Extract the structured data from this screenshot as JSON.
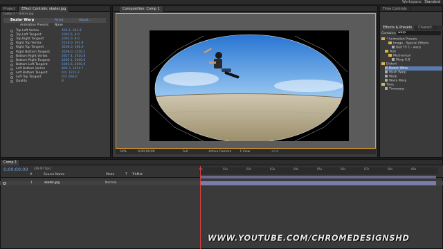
{
  "workspace": {
    "label": "Workspace:",
    "value": "Standard"
  },
  "left_panel": {
    "tabs": [
      "Project",
      "Effect Controls: skater.jpg"
    ],
    "breadcrumb": "Comp 1 * skater.jpg",
    "effect": {
      "name": "Bezier Warp",
      "reset": "Reset",
      "about": "About..."
    },
    "animation_presets": {
      "label": "Animation Presets:",
      "value": "None"
    },
    "properties": [
      {
        "label": "Top Left Vertex",
        "value": "426.1, 361.8"
      },
      {
        "label": "Top Left Tangent",
        "value": "1003.6, 8.0"
      },
      {
        "label": "Top Right Tangent",
        "value": "2003.0, 8.0"
      },
      {
        "label": "Right Top Vertex",
        "value": "2518.0, 361.8"
      },
      {
        "label": "Right Top Tangent",
        "value": "3508.0, 586.6"
      },
      {
        "label": "Right Bottom Tangent",
        "value": "3508.0, 1250.2"
      },
      {
        "label": "Bottom Right Vertex",
        "value": "2627.4, 1610.8"
      },
      {
        "label": "Bottom Right Tangent",
        "value": "2005.1, 2000.0"
      },
      {
        "label": "Bottom Left Tangent",
        "value": "1003.6, 2000.0"
      },
      {
        "label": "Left Bottom Vertex",
        "value": "404.3, 1654.7"
      },
      {
        "label": "Left Bottom Tangent",
        "value": "0.0, 1223.2"
      },
      {
        "label": "Left Top Tangent",
        "value": "0.0, 666.6"
      },
      {
        "label": "Quality",
        "value": "8"
      }
    ]
  },
  "viewer": {
    "tab": "Composition: Comp 1",
    "breadcrumb": "Comp 1",
    "zoom": "50%",
    "timecode": "0;00;00;00",
    "resolution": "Full",
    "camera": "Active Camera",
    "view": "1 View",
    "offset": "+0.0"
  },
  "right_panel": {
    "top_tab": "Time Controls",
    "tabs": [
      "Effects & Presets",
      "Charact"
    ],
    "search_label": "Contains:",
    "search_value": "warp",
    "tree": [
      {
        "text": "* Animation Presets",
        "level": 0,
        "kind": "folder"
      },
      {
        "text": "Image - Special Effects",
        "level": 2,
        "kind": "folder"
      },
      {
        "text": "Bad TV 1 - warp",
        "level": 3,
        "kind": "fx"
      },
      {
        "text": "Text",
        "level": 1,
        "kind": "folder"
      },
      {
        "text": "Mechanical",
        "level": 2,
        "kind": "folder"
      },
      {
        "text": "Warp 9.8",
        "level": 3,
        "kind": "fx"
      },
      {
        "text": "Distort",
        "level": 0,
        "kind": "folder"
      },
      {
        "text": "Bezier Warp",
        "level": 1,
        "kind": "fx",
        "selected": true
      },
      {
        "text": "Mesh Warp",
        "level": 1,
        "kind": "fx"
      },
      {
        "text": "Warp",
        "level": 1,
        "kind": "fx"
      },
      {
        "text": "Wave Warp",
        "level": 1,
        "kind": "fx"
      },
      {
        "text": "Time",
        "level": 0,
        "kind": "folder"
      },
      {
        "text": "Timewarp",
        "level": 1,
        "kind": "fx"
      }
    ]
  },
  "timeline": {
    "tab": "Comp 1",
    "timecode": "0;00;00;00",
    "fps": "(29.97 fps)",
    "columns": [
      "#",
      "Source Name",
      "Mode",
      "T",
      "TrkMat"
    ],
    "layer": {
      "num": "1",
      "name": "skater.jpg",
      "mode": "Normal",
      "trkmat": ""
    },
    "ruler_ticks": [
      "0s",
      "01s",
      "02s",
      "03s",
      "04s",
      "05s",
      "06s",
      "07s",
      "08s",
      "09s"
    ]
  },
  "watermark": "WWW.YOUTUBE.COM/CHROMEDESIGNSHD",
  "colors": {
    "accent_orange": "#e0a030",
    "link_blue": "#6fa4e6",
    "playhead": "#e04040"
  }
}
